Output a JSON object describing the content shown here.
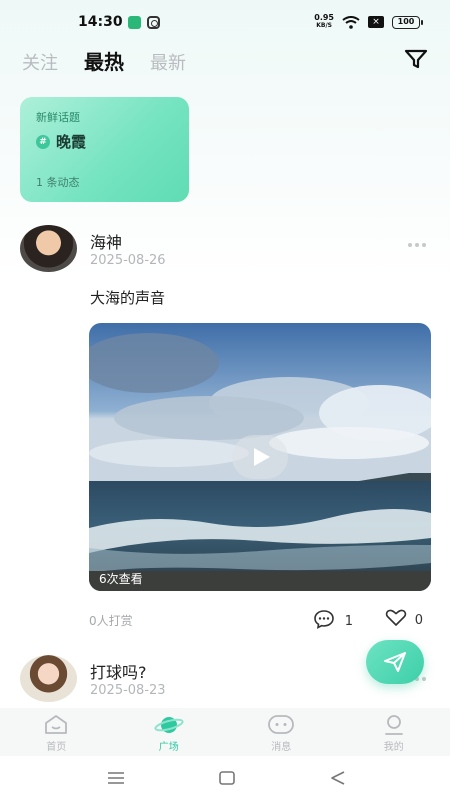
{
  "status_bar": {
    "time": "14:30",
    "net_speed_value": "0.95",
    "net_speed_unit": "KB/S",
    "sim_status": "×",
    "battery": "100"
  },
  "top_tabs": [
    {
      "label": "关注",
      "active": false
    },
    {
      "label": "最热",
      "active": true
    },
    {
      "label": "最新",
      "active": false
    }
  ],
  "topic_card": {
    "tag": "新鲜话题",
    "hash": "#",
    "title": "晚霞",
    "count": "1 条动态"
  },
  "posts": [
    {
      "username": "海神",
      "date": "2025-08-26",
      "text": "大海的声音",
      "views": "6次查看",
      "tips": "0人打赏",
      "comments": "1",
      "likes": "0"
    },
    {
      "username": "打球吗?",
      "date": "2025-08-23"
    }
  ],
  "bottom_nav": [
    {
      "label": "首页",
      "icon": "home-icon",
      "active": false
    },
    {
      "label": "广场",
      "icon": "planet-icon",
      "active": true
    },
    {
      "label": "消息",
      "icon": "message-icon",
      "active": false
    },
    {
      "label": "我的",
      "icon": "profile-icon",
      "active": false
    }
  ],
  "colors": {
    "accent": "#2fc9a0",
    "inactive": "#b7babd"
  }
}
